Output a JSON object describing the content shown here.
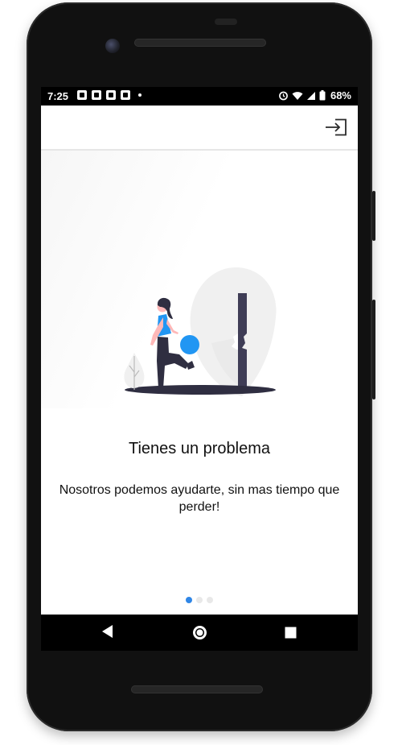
{
  "status_bar": {
    "time": "7:25",
    "battery": "68%"
  },
  "app_bar": {
    "action_icon": "login-icon"
  },
  "slide": {
    "title": "Tienes un problema",
    "description": "Nosotros podemos ayudarte, sin mas tiempo que perder!",
    "illustration": "woman-kicking-ball-illustration"
  },
  "pager": {
    "total": 3,
    "active_index": 0,
    "active_color": "#2f86e6"
  },
  "nav": {
    "back_icon": "back-triangle-icon",
    "home_icon": "home-circle-icon",
    "recents_icon": "recents-square-icon"
  }
}
